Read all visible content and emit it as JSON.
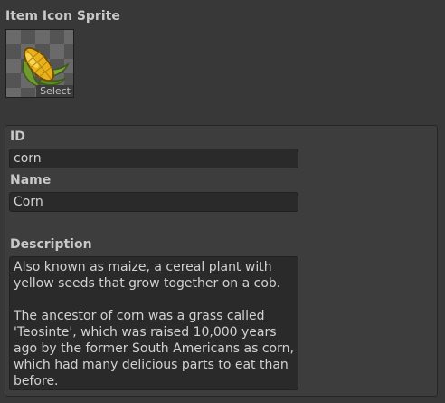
{
  "sprite": {
    "heading": "Item Icon Sprite",
    "select_label": "Select",
    "icon": "corn-icon"
  },
  "fields": {
    "id": {
      "label": "ID",
      "value": "corn"
    },
    "name": {
      "label": "Name",
      "value": "Corn"
    },
    "description": {
      "label": "Description",
      "paragraph1": "Also known as maize, a cereal plant with yellow seeds that grow together on a cob.",
      "paragraph2": "The ancestor of corn was a grass called 'Teosinte', which was raised 10,000 years ago by the former South Americans as corn, which had many delicious parts to eat than before."
    }
  },
  "colors": {
    "background": "#383838",
    "panel": "#3d3d3d",
    "field": "#2a2a2a",
    "text": "#d2d2d2"
  }
}
